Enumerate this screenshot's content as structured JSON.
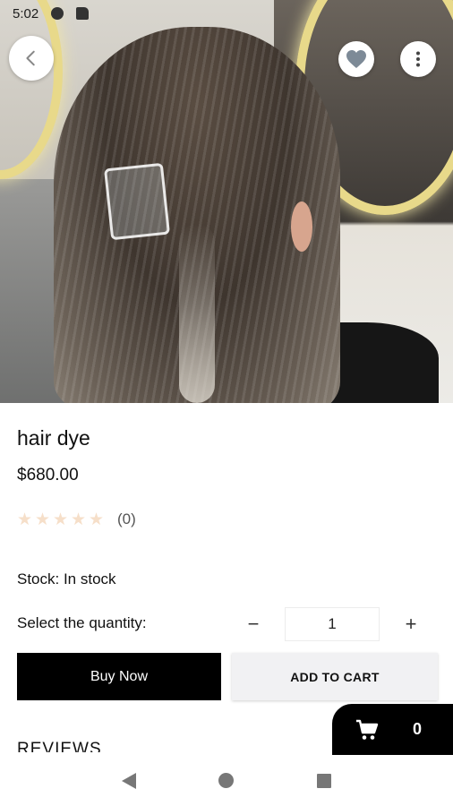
{
  "status_bar": {
    "time": "5:02",
    "icons": [
      "gear-icon",
      "sd-card-icon"
    ]
  },
  "top_actions": {
    "back_icon": "chevron-left-icon",
    "favorite_icon": "heart-icon",
    "more_icon": "more-vertical-icon"
  },
  "product": {
    "title": "hair dye",
    "price": "$680.00",
    "rating": {
      "stars": 0,
      "max_stars": 5,
      "count_text": "(0)"
    },
    "stock": "Stock: In stock",
    "quantity_label": "Select the quantity:",
    "quantity": "1",
    "minus_symbol": "−",
    "plus_symbol": "+"
  },
  "actions": {
    "buy_now": "Buy Now",
    "add_to_cart": "ADD TO CART"
  },
  "reviews_heading": "REVIEWS",
  "cart": {
    "count": "0",
    "icon": "cart-icon"
  },
  "colors": {
    "accent": "#000000",
    "secondary_button": "#f1f1f3",
    "star_empty": "#f6dfc9"
  }
}
